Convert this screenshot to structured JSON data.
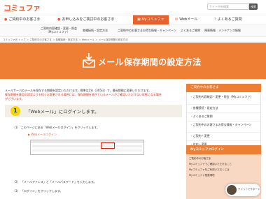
{
  "header": {
    "logo": "コミュファ",
    "logo_sub": "commufa",
    "search_placeholder": "サイト内を検索",
    "search_button": "検索"
  },
  "topnav": [
    {
      "label": "ご契約中のお客さま",
      "icon": "●"
    },
    {
      "label": "お申し込みをご検討中のお客さま",
      "icon": "●"
    },
    {
      "label": "Myコミュファ",
      "icon": "▣"
    },
    {
      "label": "Webメール",
      "icon": "✉"
    },
    {
      "label": "よくあるご質問",
      "icon": "?"
    }
  ],
  "subnav": [
    {
      "line1": "ご契約内容確認・変更・照会",
      "line2": "（Myコミュファ）"
    },
    {
      "line1": "各種接続・設定方法",
      "line2": ""
    },
    {
      "line1": "ご契約中のお客さまお得な情報・キャンペーン",
      "line2": ""
    },
    {
      "line1": "よくあるご質問",
      "line2": ""
    },
    {
      "line1": "障害情報",
      "line2": ""
    },
    {
      "line1": "メンテナンス情報",
      "line2": ""
    }
  ],
  "breadcrumb": "コミュファ光 トップ ＞ ご契約中のお客さま ＞ 各種接続・設定方法 ＞ Webメール ＞ メール保存期間の設定方法",
  "hero": {
    "title": "メール保存期間の設定方法"
  },
  "intro": {
    "line1": "メールサーバのメールを保存する期間を設定いただけます。標準は1年（365日）で、最長期間に変更いただけます。",
    "line2": "保存期間を既定の設定よりも短くお変更される場合には、保存期間を過ぎているメールがご確認いただけない状態になる場合",
    "line3": "がございます。"
  },
  "step": {
    "number": "1",
    "text": "「Webメール」にログインします。"
  },
  "instructions": {
    "s1": "（1） このページにある「Webメールログイン」をクリックします。",
    "link": "Webメールログイン",
    "s2": "（2） 「メールアドレス」と「メールパスワード」を入力します。",
    "s3": "（3） 「ログイン」をクリックします。"
  },
  "sidebar": {
    "head": "ご契約中のお客さま",
    "items": [
      "ご契約内容確認・変更・照会（Myコミュファ）",
      "各種接続・設定方法",
      "よくあるご質問",
      "ご契約中のお客さまお得な情報・キャンペーン",
      "ご契約・変更",
      "対応・変更",
      "通信の状態・規定"
    ],
    "head2": "Myコミュファログイン",
    "links": [
      "ご契約中のお客さま",
      "Myコミュファでご確認いただけること",
      "Myコミュファをご利用いただくには",
      "Myコミュファ推奨環境"
    ]
  },
  "chat": {
    "label": "チャットでサポート"
  }
}
